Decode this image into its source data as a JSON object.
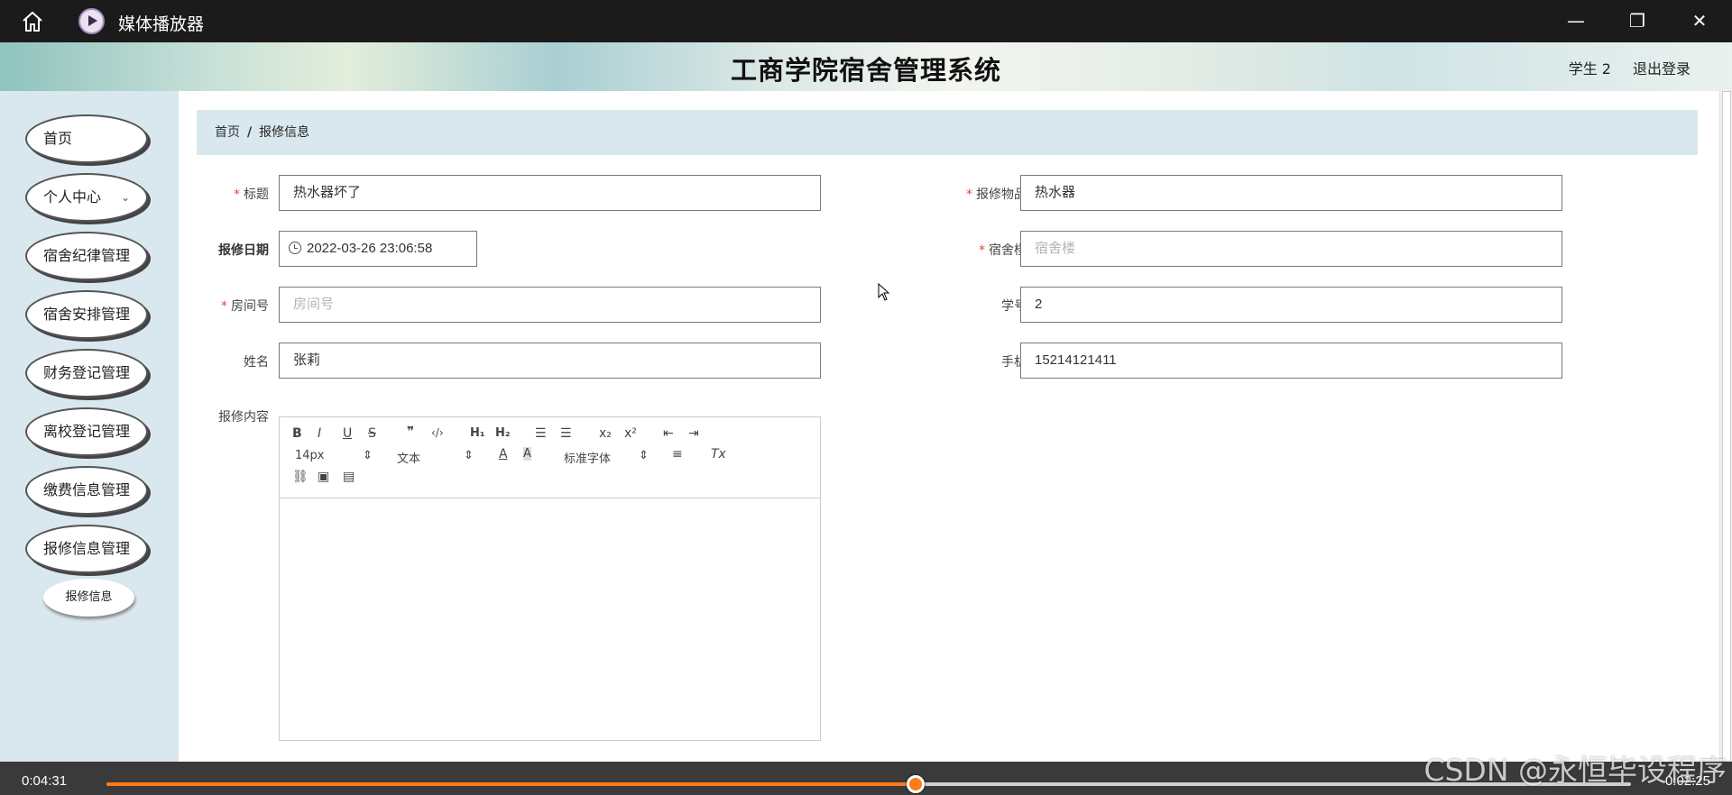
{
  "window": {
    "title": "媒体播放器",
    "home_icon": "home-icon",
    "app_icon": "media-player-icon"
  },
  "header": {
    "system_title": "工商学院宿舍管理系统",
    "user": "学生 2",
    "logout": "退出登录"
  },
  "sidebar": {
    "items": [
      {
        "label": "首页"
      },
      {
        "label": "个人中心",
        "icon": "chevron-down-icon"
      },
      {
        "label": "宿舍纪律管理"
      },
      {
        "label": "宿舍安排管理"
      },
      {
        "label": "财务登记管理"
      },
      {
        "label": "离校登记管理"
      },
      {
        "label": "缴费信息管理"
      },
      {
        "label": "报修信息管理"
      }
    ],
    "submenu": {
      "label": "报修信息"
    }
  },
  "breadcrumb": {
    "home": "首页",
    "separator": "/",
    "current": "报修信息"
  },
  "form": {
    "title": {
      "label": "标题",
      "required": "*",
      "value": "热水器坏了"
    },
    "repair_item": {
      "label": "报修物品",
      "required": "*",
      "value": "热水器"
    },
    "repair_date": {
      "label": "报修日期",
      "value": "2022-03-26 23:06:58"
    },
    "dorm_building": {
      "label": "宿舍楼",
      "required": "*",
      "placeholder": "宿舍楼"
    },
    "room_no": {
      "label": "房间号",
      "required": "*",
      "placeholder": "房间号"
    },
    "student_no": {
      "label": "学号",
      "value": "2"
    },
    "name": {
      "label": "姓名",
      "value": "张莉"
    },
    "phone": {
      "label": "手机",
      "value": "15214121411"
    },
    "content": {
      "label": "报修内容"
    }
  },
  "editor_toolbar": {
    "font_size": "14px",
    "text_type": "文本",
    "font_family": "标准字体",
    "buttons": [
      "B",
      "I",
      "U",
      "S",
      "❞",
      "‹/›",
      "H₁",
      "H₂",
      "x₂",
      "x²",
      "Tx"
    ]
  },
  "player": {
    "elapsed": "0:04:31",
    "remaining": "0:02:25",
    "progress": 0.531,
    "accent": "#ff7a1a"
  },
  "watermark": "CSDN @永恒毕设程序"
}
